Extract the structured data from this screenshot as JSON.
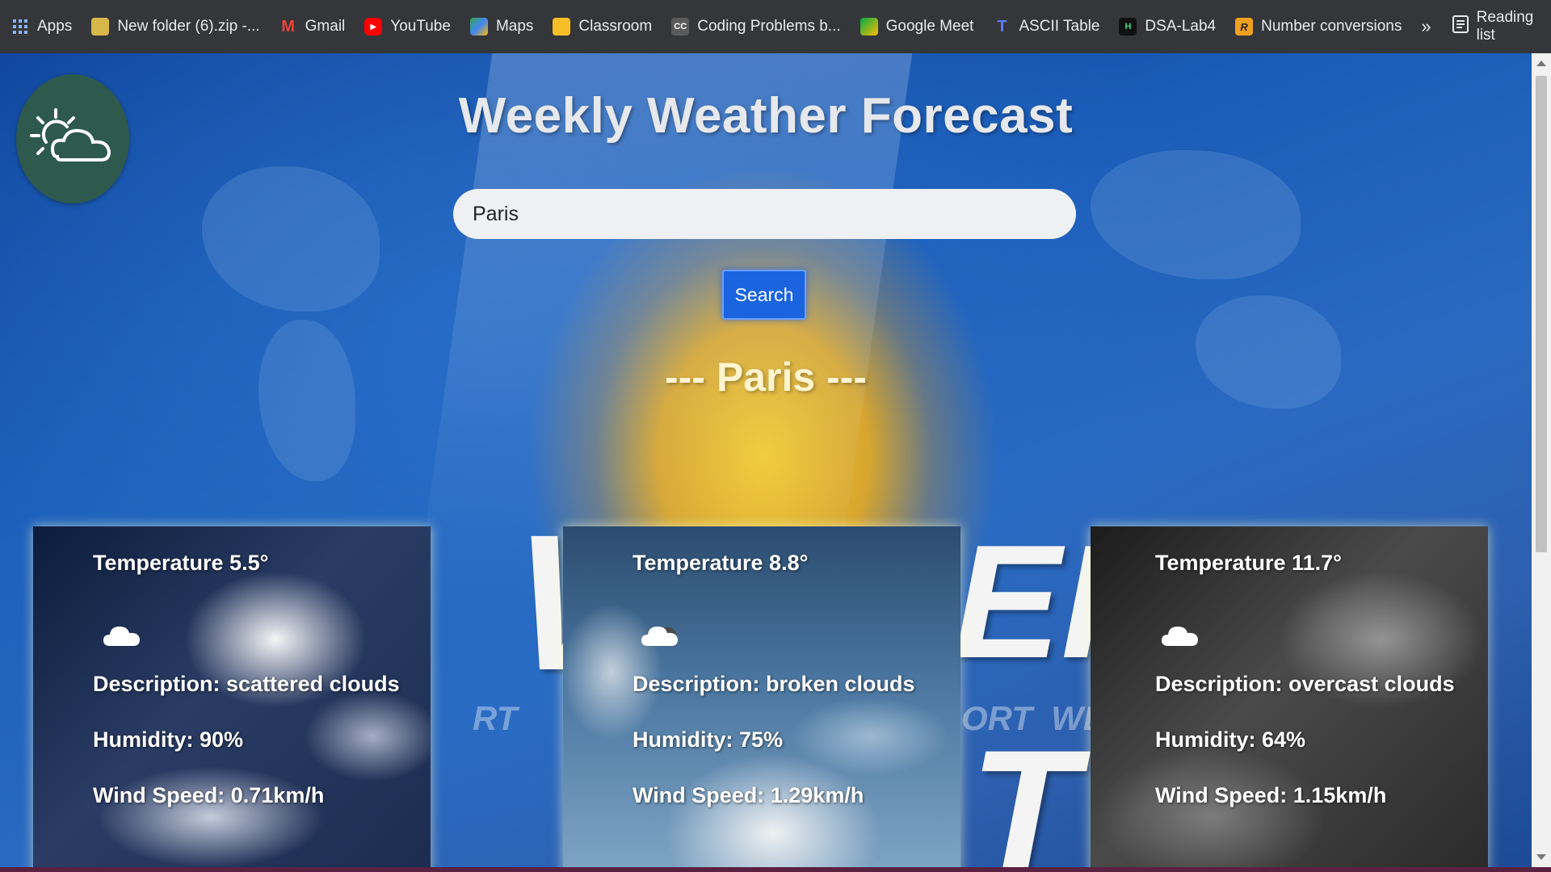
{
  "bookmarks": {
    "items": [
      {
        "label": "Apps",
        "icon": "apps-grid-icon"
      },
      {
        "label": "New folder (6).zip -...",
        "icon": "folder-icon"
      },
      {
        "label": "Gmail",
        "icon": "gmail-icon"
      },
      {
        "label": "YouTube",
        "icon": "youtube-icon"
      },
      {
        "label": "Maps",
        "icon": "maps-icon"
      },
      {
        "label": "Classroom",
        "icon": "classroom-icon"
      },
      {
        "label": "Coding Problems b...",
        "icon": "cc-icon"
      },
      {
        "label": "Google Meet",
        "icon": "meet-icon"
      },
      {
        "label": "ASCII Table",
        "icon": "ascii-icon"
      },
      {
        "label": "DSA-Lab4",
        "icon": "dsa-icon"
      },
      {
        "label": "Number conversions",
        "icon": "r-icon"
      }
    ],
    "overflow": "»",
    "reading_list": "Reading list"
  },
  "page": {
    "title": "Weekly Weather Forecast",
    "search": {
      "value": "Paris",
      "button_label": "Search"
    },
    "city_heading": "--- Paris ---"
  },
  "forecast": [
    {
      "temperature": "Temperature 5.5°",
      "description": "Description: scattered clouds",
      "humidity": "Humidity: 90%",
      "wind": "Wind Speed: 0.71km/h",
      "icon": "cloud-icon"
    },
    {
      "temperature": "Temperature 8.8°",
      "description": "Description: broken clouds",
      "humidity": "Humidity: 75%",
      "wind": "Wind Speed: 1.29km/h",
      "icon": "cloud-icon"
    },
    {
      "temperature": "Temperature 11.7°",
      "description": "Description: overcast clouds",
      "humidity": "Humidity: 64%",
      "wind": "Wind Speed: 1.15km/h",
      "icon": "cloud-icon"
    }
  ],
  "colors": {
    "bookmark_bar": "#35363a",
    "search_button": "#1a64e0",
    "logo_circle": "#2e5a4e"
  }
}
